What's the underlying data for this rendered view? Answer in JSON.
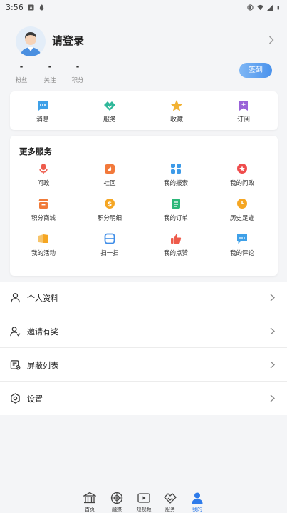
{
  "status_bar": {
    "time": "3:56",
    "left_icons": [
      "notification-a-icon",
      "bug-icon"
    ],
    "right_icons": [
      "vibrate-icon",
      "wifi-icon",
      "signal-icon",
      "battery-icon"
    ]
  },
  "profile": {
    "login_label": "请登录",
    "stats": [
      {
        "value": "-",
        "label": "粉丝"
      },
      {
        "value": "-",
        "label": "关注"
      },
      {
        "value": "-",
        "label": "积分"
      }
    ],
    "checkin_label": "签到"
  },
  "quick_actions": [
    {
      "label": "消息",
      "icon": "message-icon",
      "color": "#3ea0e8"
    },
    {
      "label": "服务",
      "icon": "handshake-icon",
      "color": "#2fb89a"
    },
    {
      "label": "收藏",
      "icon": "star-icon",
      "color": "#f2b233"
    },
    {
      "label": "订阅",
      "icon": "subscribe-icon",
      "color": "#9a62d8"
    }
  ],
  "more_services": {
    "title": "更多服务",
    "items": [
      {
        "label": "问政",
        "icon": "microphone-icon",
        "color": "#ee5b4b"
      },
      {
        "label": "社区",
        "icon": "community-icon",
        "color": "#f2793b"
      },
      {
        "label": "我的报索",
        "icon": "grid-icon",
        "color": "#3e9be8"
      },
      {
        "label": "我的问政",
        "icon": "question-icon",
        "color": "#ef4d4d"
      },
      {
        "label": "积分商城",
        "icon": "shop-icon",
        "color": "#f07a38"
      },
      {
        "label": "积分明细",
        "icon": "coin-icon",
        "color": "#f5a623"
      },
      {
        "label": "我的订单",
        "icon": "order-icon",
        "color": "#2cb779"
      },
      {
        "label": "历史足迹",
        "icon": "clock-icon",
        "color": "#f5a623"
      },
      {
        "label": "我的活动",
        "icon": "activity-icon",
        "color": "#f5a623"
      },
      {
        "label": "扫一扫",
        "icon": "scan-icon",
        "color": "#3e8de8"
      },
      {
        "label": "我的点赞",
        "icon": "thumbs-up-icon",
        "color": "#ee5b4b"
      },
      {
        "label": "我的评论",
        "icon": "comment-icon",
        "color": "#3ea0e8"
      }
    ]
  },
  "menu": [
    {
      "label": "个人资料",
      "icon": "person-icon"
    },
    {
      "label": "邀请有奖",
      "icon": "invite-icon"
    },
    {
      "label": "屏蔽列表",
      "icon": "block-list-icon"
    },
    {
      "label": "设置",
      "icon": "settings-icon"
    }
  ],
  "bottom_nav": {
    "items": [
      {
        "label": "首页",
        "icon": "home-building-icon"
      },
      {
        "label": "融媒",
        "icon": "media-icon"
      },
      {
        "label": "短视频",
        "icon": "video-icon"
      },
      {
        "label": "服务",
        "icon": "service-icon"
      },
      {
        "label": "我的",
        "icon": "user-icon"
      }
    ],
    "active_index": 4,
    "active_color": "#2e7bea"
  }
}
